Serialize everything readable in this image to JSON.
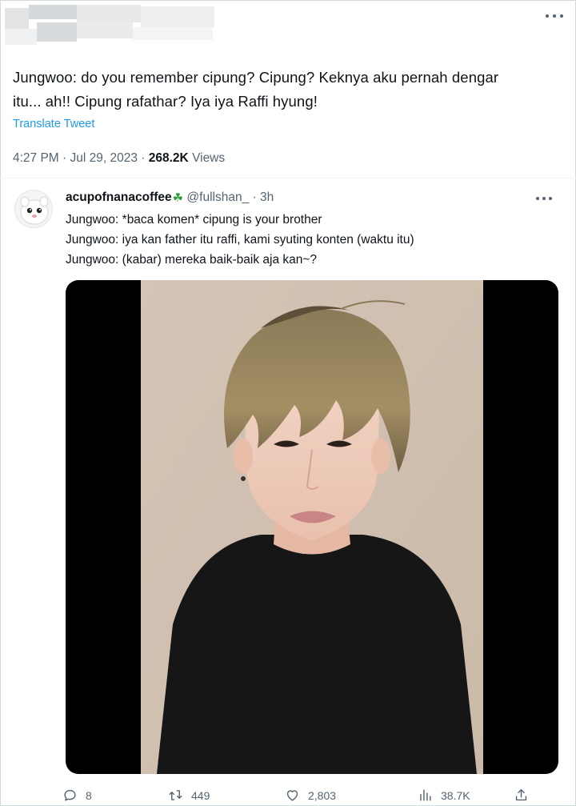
{
  "tweet": {
    "text_line1": "Jungwoo: do you remember cipung? Cipung? Keknya aku pernah dengar",
    "text_line2": "itu... ah!! Cipung rafathar? Iya iya Raffi hyung!",
    "translate_label": "Translate Tweet",
    "time": "4:27 PM",
    "date": "Jul 29, 2023",
    "views_count": "268.2K",
    "views_label": "Views",
    "separator": " · "
  },
  "reply": {
    "display_name": "acupofnanacoffee",
    "badge_icon": "shamrock-icon",
    "handle": "@fullshan_",
    "time": "3h",
    "lines": [
      "Jungwoo: *baca komen* cipung is your brother",
      "Jungwoo: iya kan father itu raffi, kami syuting konten (waktu itu)",
      "Jungwoo: (kabar) mereka baik-baik aja kan~?"
    ],
    "actions": {
      "reply_count": "8",
      "retweet_count": "449",
      "like_count": "2,803",
      "view_count": "38.7K"
    }
  },
  "colors": {
    "accent": "#1d9bf0",
    "text": "#0f1419",
    "muted": "#536471",
    "media_bg": "#000000"
  }
}
